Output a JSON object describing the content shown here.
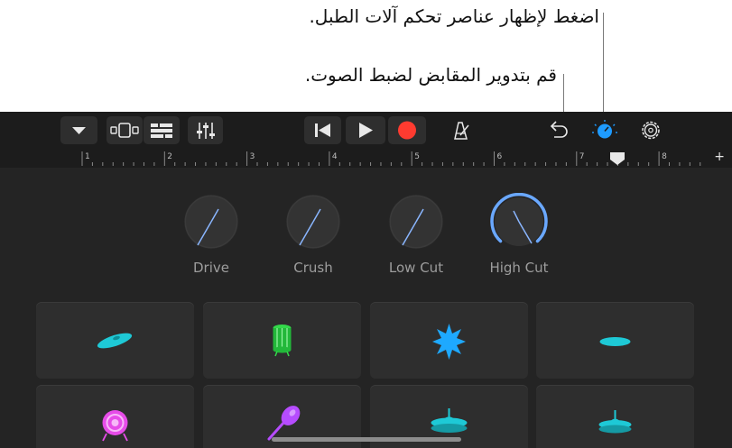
{
  "callouts": {
    "drum_controls": "اضغط لإظهار عناصر تحكم آلات الطبل.",
    "turn_knobs": "قم بتدوير المقابض لضبط الصوت."
  },
  "toolbar": {
    "buttons": [
      {
        "name": "browser-menu-button",
        "icon": "triangle-down-icon"
      },
      {
        "name": "instrument-view-button",
        "icon": "view-toggle-icon"
      },
      {
        "name": "tracks-view-button",
        "icon": "tracks-icon"
      },
      {
        "name": "mixer-button",
        "icon": "mixer-icon"
      },
      {
        "name": "go-to-start-button",
        "icon": "skip-back-icon"
      },
      {
        "name": "play-button",
        "icon": "play-icon"
      },
      {
        "name": "record-button",
        "icon": "record-icon"
      },
      {
        "name": "metronome-button",
        "icon": "metronome-icon"
      },
      {
        "name": "undo-button",
        "icon": "undo-icon"
      },
      {
        "name": "controls-button",
        "icon": "knob-icon"
      },
      {
        "name": "settings-button",
        "icon": "gear-icon"
      }
    ],
    "colors": {
      "record": "#ff3b30",
      "active": "#1e9bff"
    }
  },
  "ruler": {
    "bars": [
      "1",
      "2",
      "3",
      "4",
      "5",
      "6",
      "7",
      "8"
    ],
    "add_label": "+"
  },
  "knobs": [
    {
      "label": "Drive",
      "active": false
    },
    {
      "label": "Crush",
      "active": false
    },
    {
      "label": "Low Cut",
      "active": false
    },
    {
      "label": "High Cut",
      "active": true
    }
  ],
  "pads": [
    {
      "icon": "crash-cymbal-icon",
      "color": "#1ec9d6"
    },
    {
      "icon": "tom-drum-icon",
      "color": "#33d94a"
    },
    {
      "icon": "burst-icon",
      "color": "#1ea9ff"
    },
    {
      "icon": "hihat-closed-icon",
      "color": "#1ec9d6"
    },
    {
      "icon": "kick-drum-icon",
      "color": "#e64ce8"
    },
    {
      "icon": "maraca-icon",
      "color": "#b64cff"
    },
    {
      "icon": "cymbal-icon",
      "color": "#1ec9d6"
    },
    {
      "icon": "hihat-icon",
      "color": "#1ec9d6"
    }
  ]
}
